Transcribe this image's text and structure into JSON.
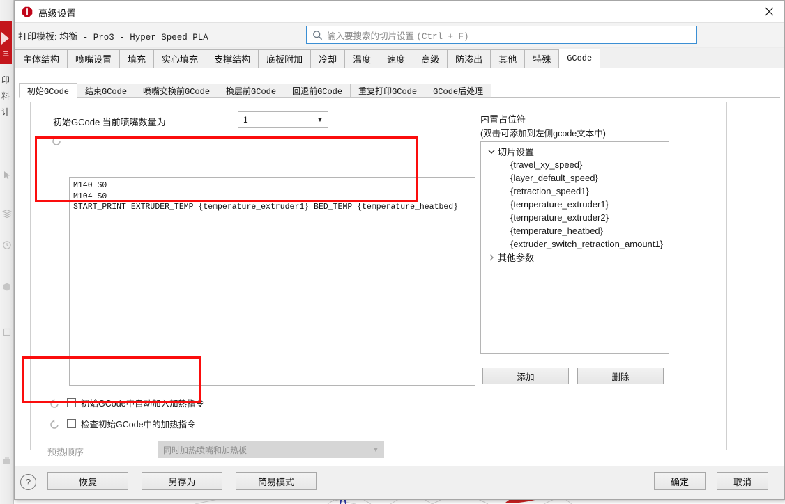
{
  "window": {
    "title": "高级设置",
    "close_label": "✕",
    "info_icon": "info-icon"
  },
  "subbar": {
    "template_prefix": "打印模板: ",
    "template_name_cn": "均衡",
    "template_name_rest": " - Pro3 - Hyper Speed PLA",
    "search_placeholder_cn": "输入要搜索的切片设置",
    "search_placeholder_hint": "(Ctrl + F)"
  },
  "main_tabs": [
    {
      "label": "主体结构",
      "active": false
    },
    {
      "label": "喷嘴设置",
      "active": false
    },
    {
      "label": "填充",
      "active": false
    },
    {
      "label": "实心填充",
      "active": false
    },
    {
      "label": "支撑结构",
      "active": false
    },
    {
      "label": "底板附加",
      "active": false
    },
    {
      "label": "冷却",
      "active": false
    },
    {
      "label": "温度",
      "active": false
    },
    {
      "label": "速度",
      "active": false
    },
    {
      "label": "高级",
      "active": false
    },
    {
      "label": "防渗出",
      "active": false
    },
    {
      "label": "其他",
      "active": false
    },
    {
      "label": "特殊",
      "active": false
    },
    {
      "label": "GCode",
      "active": true
    }
  ],
  "sub_tabs": [
    {
      "label": "初始GCode",
      "active": true
    },
    {
      "label": "结束GCode",
      "active": false
    },
    {
      "label": "喷嘴交换前GCode",
      "active": false
    },
    {
      "label": "换层前GCode",
      "active": false
    },
    {
      "label": "回退前GCode",
      "active": false
    },
    {
      "label": "重复打印GCode",
      "active": false
    },
    {
      "label": "GCode后处理",
      "active": false
    }
  ],
  "nozzle_count": {
    "label": "初始GCode 当前喷嘴数量为",
    "value": "1"
  },
  "gcode_editor": {
    "text": "M140 S0\nM104 S0\nSTART_PRINT EXTRUDER_TEMP={temperature_extruder1} BED_TEMP={temperature_heatbed}",
    "reset_icon": "reset-icon"
  },
  "checkboxes": [
    {
      "label": "初始GCode中自动加入加热指令",
      "checked": false,
      "reset_icon": "reset-icon"
    },
    {
      "label": "检查初始GCode中的加热指令",
      "checked": false,
      "reset_icon": "reset-icon"
    }
  ],
  "preheat": {
    "label": "预热顺序",
    "value": "同时加热喷嘴和加热板",
    "disabled": true
  },
  "placeholders": {
    "title": "内置占位符",
    "subtitle": "(双击可添加到左侧gcode文本中)",
    "groups": [
      {
        "label": "切片设置",
        "expanded": true,
        "caret": "▼",
        "items": [
          "{travel_xy_speed}",
          "{layer_default_speed}",
          "{retraction_speed1}",
          "{temperature_extruder1}",
          "{temperature_extruder2}",
          "{temperature_heatbed}",
          "{extruder_switch_retraction_amount1}"
        ]
      },
      {
        "label": "其他参数",
        "expanded": false,
        "caret": "❯",
        "items": []
      }
    ],
    "add_button": "添加",
    "delete_button": "删除"
  },
  "footer": {
    "help_icon": "?",
    "restore": "恢复",
    "save_as": "另存为",
    "simple_mode": "简易模式",
    "ok": "确定",
    "cancel": "取消"
  },
  "background_rail": {
    "chars": [
      "印",
      "料",
      "计"
    ],
    "red_label": "三"
  },
  "colors": {
    "accent_blue": "#3b8fd4",
    "annotation_red": "#fb0d0d",
    "brand_red": "#c4161c",
    "dialog_bg": "#f0f0f0"
  }
}
